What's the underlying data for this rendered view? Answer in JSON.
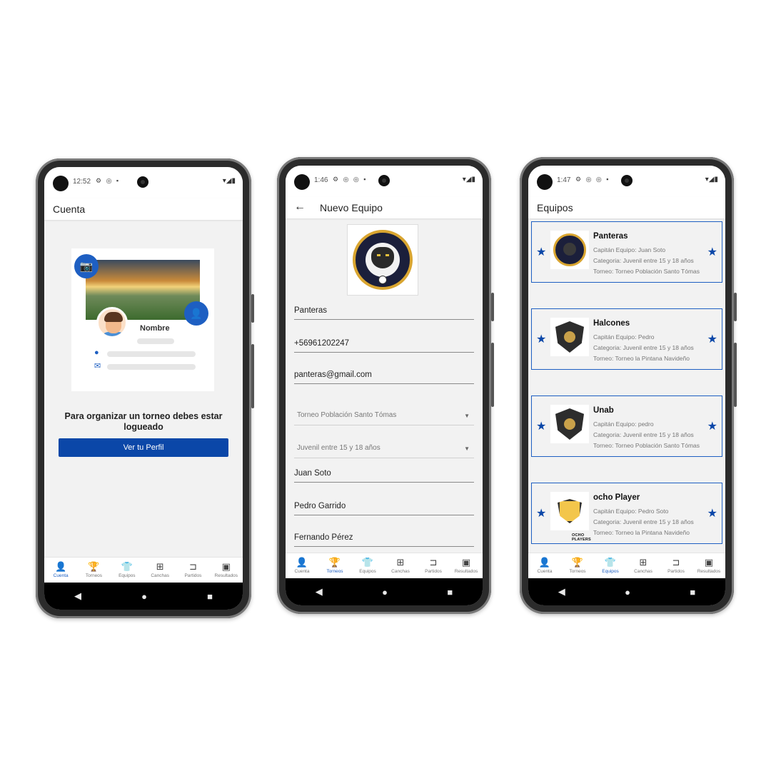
{
  "phones": [
    {
      "status": {
        "time": "12:52",
        "icons": "⚙ ◎ ▪"
      },
      "title": "Cuenta",
      "profile": {
        "name": "Nombre"
      },
      "notice": "Para organizar un torneo debes estar logueado",
      "button": "Ver tu Perfil",
      "active_tab": "Cuenta"
    },
    {
      "status": {
        "time": "1:46",
        "icons": "⚙ ◎ ◎ ▪"
      },
      "title": "Nuevo Equipo",
      "fields": [
        "Panteras",
        "+56961202247",
        "panteras@gmail.com"
      ],
      "selects": [
        "Torneo Población Santo Tómas",
        "Juvenil entre 15 y 18 años"
      ],
      "players": [
        "Juan Soto",
        "Pedro Garrido",
        "Fernando Pérez"
      ],
      "active_tab": "Torneos"
    },
    {
      "status": {
        "time": "1:47",
        "icons": "⚙ ◎ ◎ ▪"
      },
      "title": "Equipos",
      "teams": [
        {
          "name": "Panteras",
          "captain": "Capitán Equipo: Juan Soto",
          "category": "Categoria: Juvenil entre 15 y 18 años",
          "tournament": "Torneo: Torneo Población Santo Tómas",
          "logo": "panther-logo"
        },
        {
          "name": "Halcones",
          "captain": "Capitán Equipo: Pedro",
          "category": "Categoria: Juvenil entre 15 y 18 años",
          "tournament": "Torneo: Torneo la Pintana Navideño",
          "logo": "crest-logo"
        },
        {
          "name": "Unab",
          "captain": "Capitán Equipo: pedro",
          "category": "Categoria: Juvenil entre 15 y 18 años",
          "tournament": "Torneo: Torneo Población Santo Tómas",
          "logo": "crest-logo"
        },
        {
          "name": "ocho Player",
          "captain": "Capitán Equipo: Pedro Soto",
          "category": "Categoria: Juvenil entre 15 y 18 años",
          "tournament": "Torneo: Torneo la Pintana Navideño",
          "logo": "shield-logo",
          "logo_text": "OCHO PLAYERS"
        }
      ],
      "active_tab": "Equipos"
    }
  ],
  "nav": [
    {
      "label": "Cuenta",
      "icon": "person-icon",
      "glyph": "👤"
    },
    {
      "label": "Torneos",
      "icon": "trophy-icon",
      "glyph": "🏆"
    },
    {
      "label": "Equipos",
      "icon": "shirt-icon",
      "glyph": "👕"
    },
    {
      "label": "Canchas",
      "icon": "field-icon",
      "glyph": "⊞"
    },
    {
      "label": "Partidos",
      "icon": "bracket-icon",
      "glyph": "⊐"
    },
    {
      "label": "Resultados",
      "icon": "scoreboard-icon",
      "glyph": "▣"
    }
  ],
  "colors": {
    "accent": "#1e5fc2",
    "button": "#0b47a8"
  }
}
